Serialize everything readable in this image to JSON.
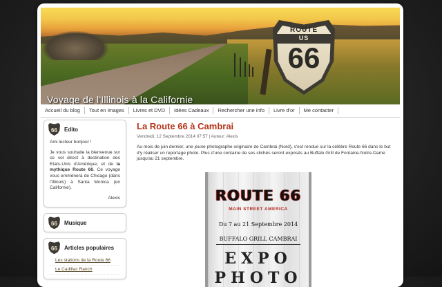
{
  "header": {
    "site_title": "Voyage de l'Illinois à la Californie",
    "sign": {
      "top": "ROUTE",
      "middle": "US",
      "number": "66"
    }
  },
  "nav": {
    "items": [
      "Accueil du blog",
      "Tout en images",
      "Livres et DVD",
      "Idées Cadeaux",
      "Rechercher une info",
      "Livre d'or",
      "Me contacter"
    ]
  },
  "sidebar": {
    "edito": {
      "title": "Edito",
      "greeting": "Ami lecteur bonjour !",
      "text_before": "Je vous souhaite la bienvenue sur ce vol direct à destination des Etats-Unis d'Amérique, et de ",
      "text_bold": "la mythique Route 66",
      "text_after": ". Ce voyage vous emmènera de Chicago (dans l'Illinois) à Santa Monica (en Californie).",
      "signature": "Alexis"
    },
    "music": {
      "title": "Musique"
    },
    "popular": {
      "title": "Articles populaires",
      "items": [
        "Les stations de la Route 66",
        "Le Cadillac Ranch"
      ]
    },
    "shield_number": "66"
  },
  "post": {
    "title": "La Route 66 à Cambrai",
    "meta": "Vendredi, 12 Septembre 2014 07:57 | Auteur: Alexis",
    "body": "Au mois de juin dernier, une jeune photographe originaire de Cambrai (Nord), s'est rendue sur la célèbre Route 66 dans le but d'y réaliser un reportage photo. Plus d'une centaine de ses clichés seront exposés au Buffalo Grill de Fontaine-Notre-Dame jusqu'au 21 septembre."
  },
  "poster": {
    "title": "ROUTE 66",
    "subtitle": "MAIN STREET AMERICA",
    "dates": "Du 7 au 21 Septembre 2014",
    "venue": "BUFFALO GRILL CAMBRAI",
    "line1": "EXPO",
    "line2": "PHOTO"
  }
}
